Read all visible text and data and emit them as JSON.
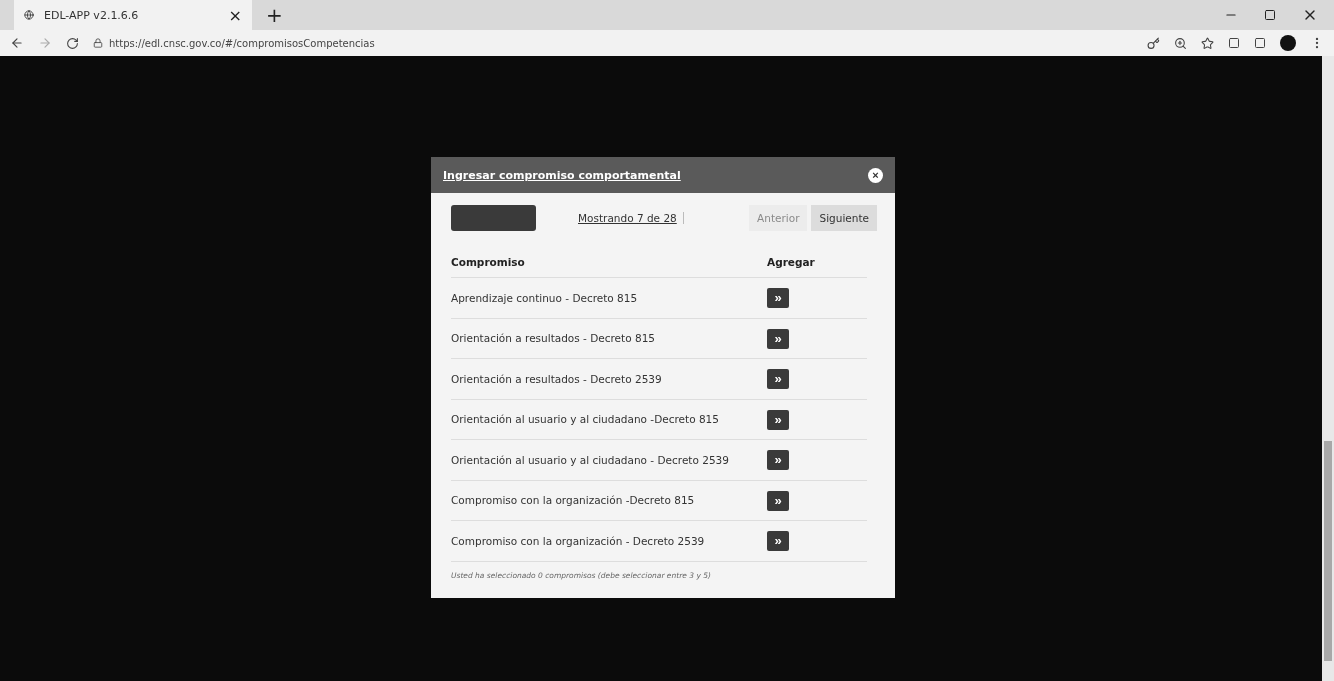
{
  "browser": {
    "tab_title": "EDL-APP v2.1.6.6",
    "tab_close": "×",
    "new_tab": "+",
    "url": "https://edl.cnsc.gov.co/#/compromisosCompetencias"
  },
  "dialog": {
    "title": "Ingresar compromiso comportamental",
    "close": "×",
    "pager": {
      "text": "Mostrando 7 de 28",
      "previous": {
        "label": "Anterior",
        "disabled": true
      },
      "next": {
        "label": "Siguiente",
        "disabled": false
      }
    },
    "columns": [
      "Compromiso",
      "Agregar"
    ],
    "rows": [
      {
        "name": "Aprendizaje continuo - Decreto 815",
        "action": "»"
      },
      {
        "name": "Orientación a resultados - Decreto 815",
        "action": "»"
      },
      {
        "name": "Orientación a resultados - Decreto 2539",
        "action": "»"
      },
      {
        "name": "Orientación al usuario y al ciudadano -Decreto 815",
        "action": "»"
      },
      {
        "name": "Orientación al usuario y al ciudadano - Decreto 2539",
        "action": "»"
      },
      {
        "name": "Compromiso con la organización -Decreto 815",
        "action": "»"
      },
      {
        "name": "Compromiso con la organización - Decreto 2539",
        "action": "»"
      }
    ],
    "footer": "Usted ha seleccionado 0 compromisos (debe seleccionar entre 3 y 5)"
  }
}
